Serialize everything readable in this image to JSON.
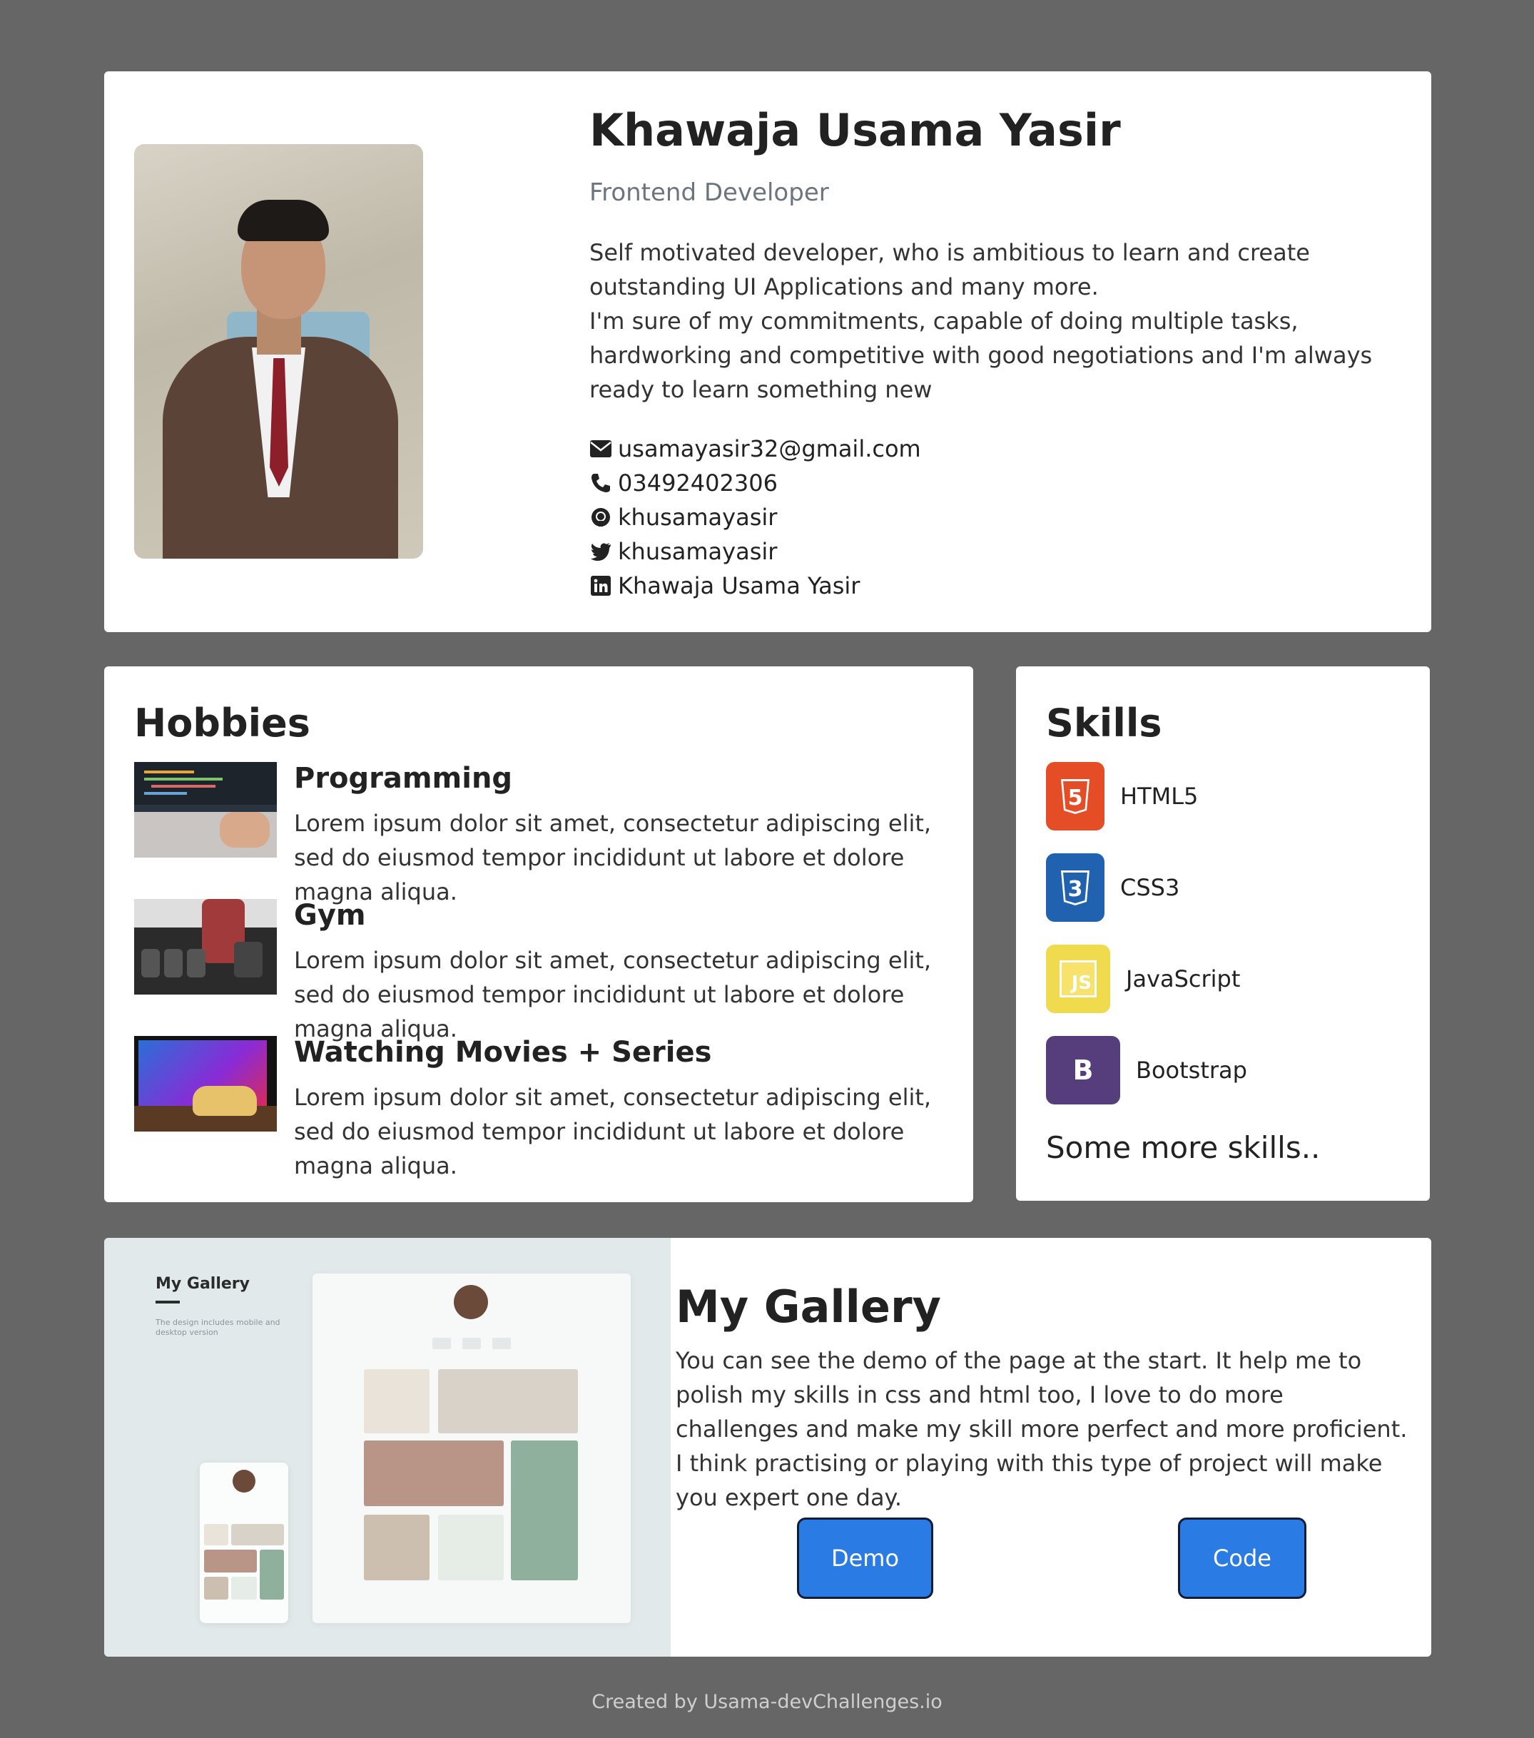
{
  "profile": {
    "name": "Khawaja Usama Yasir",
    "role": "Frontend Developer",
    "bio_1": "Self motivated developer, who is ambitious to learn and create outstanding UI Applications and many more.",
    "bio_2": "I'm sure of my commitments, capable of doing multiple tasks, hardworking and competitive with good negotiations and I'm always ready to learn something new",
    "contacts": {
      "email": "usamayasir32@gmail.com",
      "phone": "03492402306",
      "github": "khusamayasir",
      "twitter": "khusamayasir",
      "linkedin": "Khawaja Usama Yasir"
    }
  },
  "hobbies": {
    "title": "Hobbies",
    "items": [
      {
        "title": "Programming",
        "text": "Lorem ipsum dolor sit amet, consectetur adipiscing elit, sed do eiusmod tempor incididunt ut labore et dolore magna aliqua."
      },
      {
        "title": "Gym",
        "text": "Lorem ipsum dolor sit amet, consectetur adipiscing elit, sed do eiusmod tempor incididunt ut labore et dolore magna aliqua."
      },
      {
        "title": "Watching Movies + Series",
        "text": "Lorem ipsum dolor sit amet, consectetur adipiscing elit, sed do eiusmod tempor incididunt ut labore et dolore magna aliqua."
      }
    ]
  },
  "skills": {
    "title": "Skills",
    "items": [
      {
        "label": "HTML5",
        "icon": "html5-icon",
        "color": "#e44d26",
        "glyph": "5"
      },
      {
        "label": "CSS3",
        "icon": "css3-icon",
        "color": "#2062af",
        "glyph": "3"
      },
      {
        "label": "JavaScript",
        "icon": "javascript-icon",
        "color": "#f0db4f",
        "glyph": "JS"
      },
      {
        "label": "Bootstrap",
        "icon": "bootstrap-icon",
        "color": "#563d7c",
        "glyph": "B"
      }
    ],
    "more": "Some more skills.."
  },
  "gallery": {
    "title": "My Gallery",
    "text": "You can see the demo of the page at the start. It help me to polish my skills in css and html too, I love to do more challenges and make my skill more perfect and more proficient. I think practising or playing with this type of project will make you expert one day.",
    "demo_label": "Demo",
    "code_label": "Code",
    "preview": {
      "title": "My Gallery",
      "subtitle": "The design includes mobile and desktop version"
    }
  },
  "footer": "Created by Usama-devChallenges.io",
  "colors": {
    "background": "#666666",
    "button": "#2a7be4",
    "muted": "#6c757d"
  }
}
